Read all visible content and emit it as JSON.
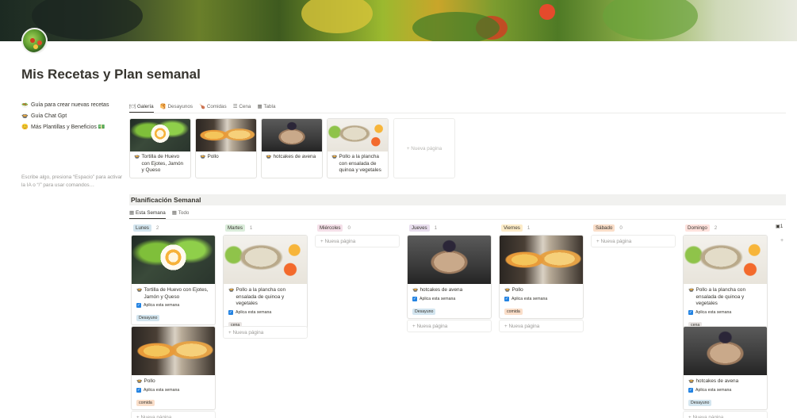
{
  "page": {
    "title": "Mis Recetas y Plan semanal",
    "links": [
      {
        "emoji": "🥗",
        "label": "Guía para crear nuevas recetas"
      },
      {
        "emoji": "🍲",
        "label": "Guía Chat Gpt"
      },
      {
        "emoji": "😊",
        "label": "Más Plantillas y Beneficios 💵"
      }
    ],
    "placeholder": "Escribe algo, presiona “Espacio” para activar la IA o “/” para usar comandos…"
  },
  "recipe_tabs": [
    {
      "icon": "🍽",
      "label": "Galería"
    },
    {
      "icon": "🥞",
      "label": "Desayunos"
    },
    {
      "icon": "🍗",
      "label": "Comidas"
    },
    {
      "icon": "☰",
      "label": "Cena"
    },
    {
      "icon": "▦",
      "label": "Tabla"
    }
  ],
  "gallery": [
    {
      "name": "Tortilla de Huevo con Ejotes, Jamón y Queso",
      "image": "tortilla"
    },
    {
      "name": "Pollo",
      "image": "pollo"
    },
    {
      "name": "hotcakes de avena",
      "image": "hotcakes"
    },
    {
      "name": "Pollo a la plancha con ensalada de quinoa y vegetales",
      "image": "plancha"
    }
  ],
  "new_page_label": "Nueva página",
  "planning": {
    "heading": "Planificación Semanal",
    "tabs": [
      {
        "icon": "▦",
        "label": "Esta Semana"
      },
      {
        "icon": "▦",
        "label": "Todo"
      }
    ],
    "checkbox_label": "Aplica esta semana",
    "columns": [
      {
        "day": "Lunes",
        "count": "2",
        "color": "#d3e5ef"
      },
      {
        "day": "Martes",
        "count": "1",
        "color": "#dbeddb"
      },
      {
        "day": "Miércoles",
        "count": "0",
        "color": "#f5e0e9"
      },
      {
        "day": "Jueves",
        "count": "1",
        "color": "#e8deee"
      },
      {
        "day": "Viernes",
        "count": "1",
        "color": "#fdecc8"
      },
      {
        "day": "Sábado",
        "count": "0",
        "color": "#fadec9"
      },
      {
        "day": "Domingo",
        "count": "2",
        "color": "#ffe2dd"
      }
    ],
    "edge_count": "1",
    "cards": {
      "lunes_1": {
        "name": "Tortilla de Huevo con Ejotes, Jamón y Queso",
        "tag": "Desayuno"
      },
      "lunes_2": {
        "name": "Pollo",
        "tag": "comida"
      },
      "martes_1": {
        "name": "Pollo a la plancha con ensalada de quinoa y vegetales",
        "tag": "cena"
      },
      "jueves_1": {
        "name": "hotcakes de avena",
        "tag": "Desayuno"
      },
      "viernes_1": {
        "name": "Pollo",
        "tag": "comida"
      },
      "domingo_1": {
        "name": "Pollo a la plancha con ensalada de quinoa y vegetales",
        "tag": "cena"
      },
      "domingo_2": {
        "name": "hotcakes de avena",
        "tag": "Desayuno"
      }
    },
    "tag_colors": {
      "Desayuno": "#d3e5ef",
      "comida": "#fadec9",
      "cena": "#e9e5e3"
    }
  }
}
